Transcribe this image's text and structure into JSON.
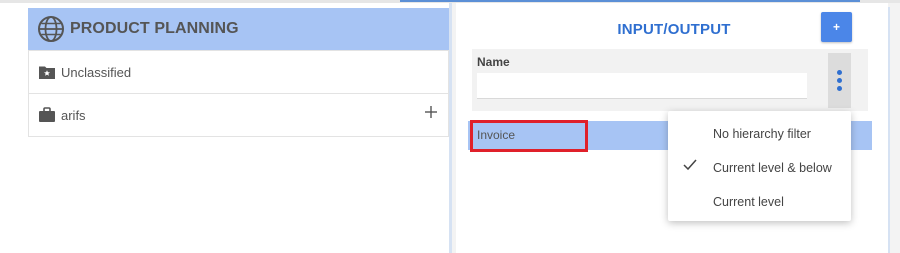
{
  "left_panel": {
    "header_title": "PRODUCT PLANNING",
    "header_icon": "globe-icon",
    "tree_items": [
      {
        "label": "Unclassified",
        "icon": "folder-star-icon"
      },
      {
        "label": "arifs",
        "icon": "briefcase-icon",
        "action_icon": "plus-icon"
      }
    ]
  },
  "right_panel": {
    "title": "INPUT/OUTPUT",
    "add_button_label": "+",
    "filter": {
      "label": "Name",
      "value": "",
      "placeholder": ""
    },
    "menu_icon": "more-vert-icon",
    "rows": [
      {
        "label": "Invoice",
        "highlighted": true
      }
    ]
  },
  "dropdown_menu": {
    "items": [
      {
        "label": "No hierarchy filter",
        "checked": false
      },
      {
        "label": "Current level & below",
        "checked": true
      },
      {
        "label": "Current level",
        "checked": false
      }
    ]
  },
  "colors": {
    "accent": "#4b86e8",
    "header_bg": "#a7c4f4",
    "title_blue": "#2f6fd0",
    "highlight_border": "#e0202a"
  }
}
